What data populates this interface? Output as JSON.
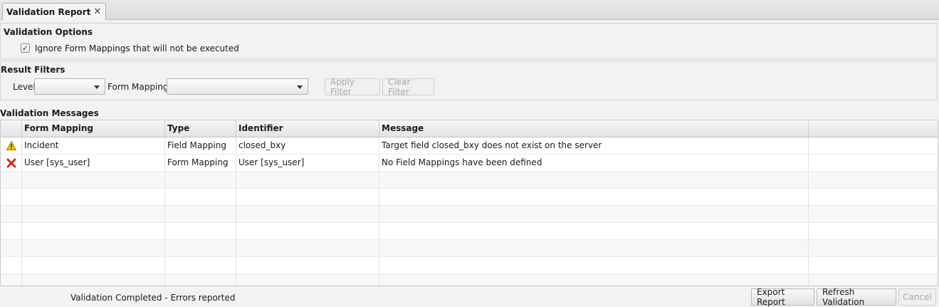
{
  "tab": {
    "title": "Validation Report",
    "close_glyph": "✕"
  },
  "options": {
    "title": "Validation Options",
    "ignore_checkbox": {
      "checked": true,
      "label": "Ignore Form Mappings that will not be executed"
    }
  },
  "filters": {
    "title": "Result Filters",
    "level_label": "Level",
    "level_value": "",
    "form_mapping_label": "Form Mapping",
    "form_mapping_value": "",
    "apply_label": "Apply Filter",
    "clear_label": "Clear Filter"
  },
  "messages": {
    "title": "Validation Messages",
    "columns": [
      "",
      "Form Mapping",
      "Type",
      "Identifier",
      "Message",
      ""
    ],
    "rows": [
      {
        "icon": "warning-icon",
        "form_mapping": "Incident",
        "type": "Field Mapping",
        "identifier": "closed_bxy",
        "message": "Target field closed_bxy does not exist on the server"
      },
      {
        "icon": "error-icon",
        "form_mapping": "User [sys_user]",
        "type": "Form Mapping",
        "identifier": "User [sys_user]",
        "message": "No Field Mappings have been defined"
      }
    ]
  },
  "status": {
    "text": "Validation Completed - Errors reported",
    "export_label": "Export Report",
    "refresh_label": "Refresh Validation",
    "cancel_label": "Cancel"
  },
  "colors": {
    "warning": "#f5c400",
    "error": "#d42a1a"
  }
}
